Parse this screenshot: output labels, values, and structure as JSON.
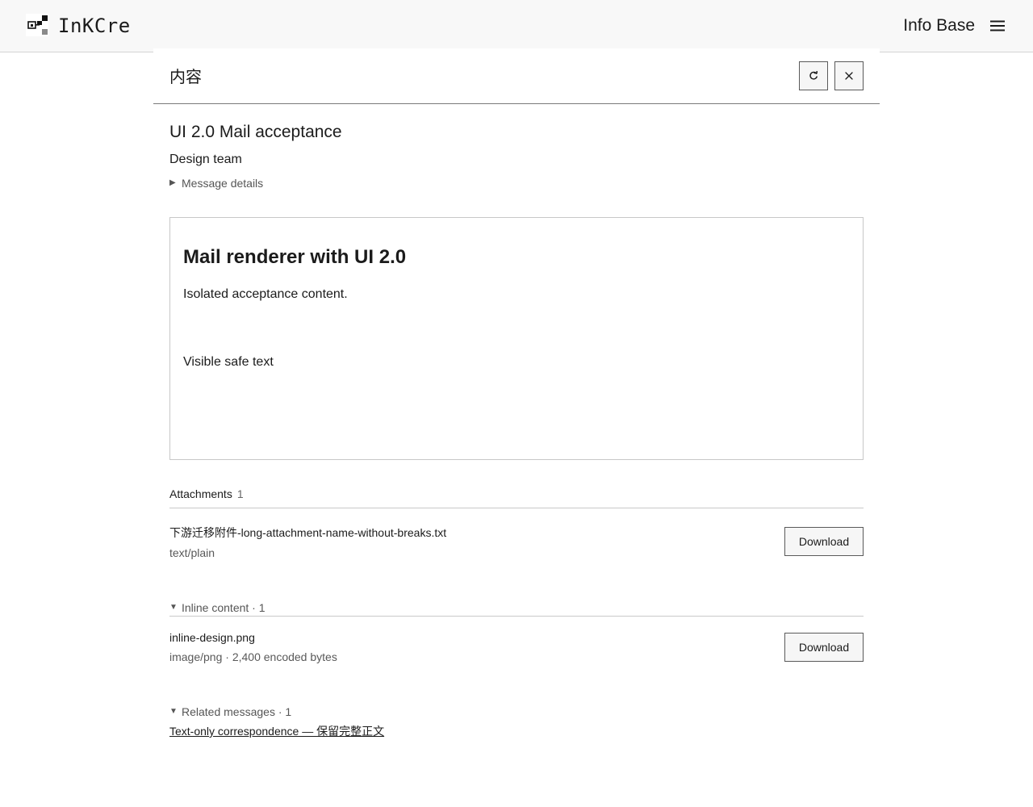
{
  "header": {
    "brand": "InKCre",
    "nav_title": "Info Base"
  },
  "panel": {
    "title": "内容"
  },
  "message": {
    "subject": "UI 2.0 Mail acceptance",
    "sender": "Design team",
    "details_label": "Message details",
    "body": {
      "heading": "Mail renderer with UI 2.0",
      "paragraph_1": "Isolated acceptance content.",
      "paragraph_2": "Visible safe text"
    }
  },
  "attachments": {
    "label": "Attachments",
    "count": "1",
    "items": [
      {
        "name": "下游迁移附件-long-attachment-name-without-breaks.txt",
        "meta": "text/plain",
        "action": "Download"
      }
    ]
  },
  "inline_content": {
    "label": "Inline content · 1",
    "items": [
      {
        "name": "inline-design.png",
        "meta": "image/png · 2,400 encoded bytes",
        "action": "Download"
      }
    ]
  },
  "related": {
    "label": "Related messages · 1",
    "items": [
      {
        "title": "Text-only correspondence — 保留完整正文"
      }
    ]
  },
  "icons": {
    "menu": "hamburger-menu-icon",
    "refresh": "refresh-icon",
    "close": "close-icon",
    "collapsed": "triangle-right-icon",
    "expanded": "triangle-down-icon"
  }
}
